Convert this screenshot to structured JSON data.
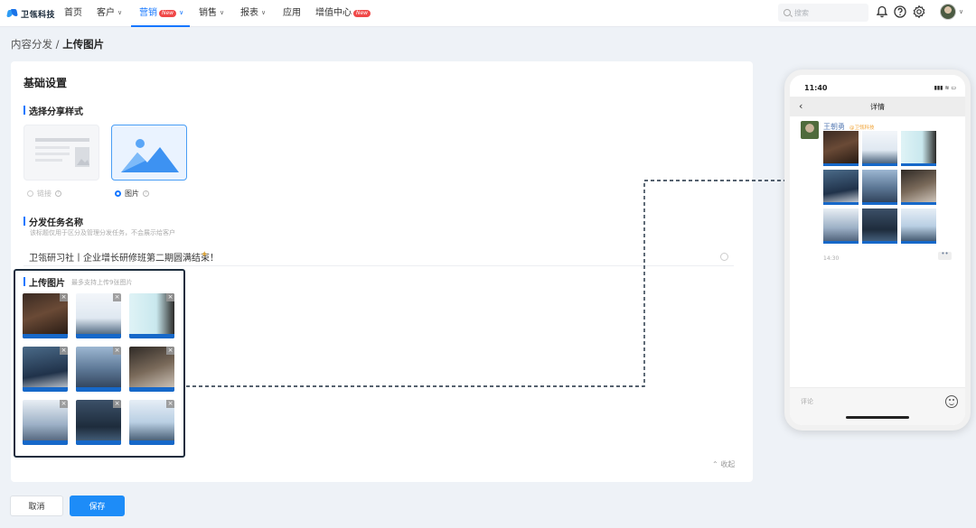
{
  "brand": {
    "name": "卫瓴科技",
    "accent": "#1677ff",
    "save_color": "#1d8cf8",
    "badge_color": "#f04848"
  },
  "nav": {
    "items": [
      {
        "label": "首页",
        "dropdown": false,
        "badge": ""
      },
      {
        "label": "客户",
        "dropdown": true,
        "badge": ""
      },
      {
        "label": "营销",
        "dropdown": true,
        "badge": "New",
        "active": true
      },
      {
        "label": "销售",
        "dropdown": true,
        "badge": ""
      },
      {
        "label": "报表",
        "dropdown": true,
        "badge": ""
      },
      {
        "label": "应用",
        "dropdown": false,
        "badge": ""
      },
      {
        "label": "增值中心",
        "dropdown": false,
        "badge": "New"
      }
    ],
    "search_placeholder": "搜索",
    "icons": [
      "bell-icon",
      "help-icon",
      "gear-icon"
    ]
  },
  "breadcrumb": {
    "parent": "内容分发",
    "separator": " / ",
    "current": "上传图片"
  },
  "form": {
    "section_title": "基础设置",
    "share_style": {
      "title": "选择分享样式",
      "options": [
        {
          "label": "链接",
          "selected": false
        },
        {
          "label": "图片",
          "selected": true
        }
      ]
    },
    "task_name": {
      "title": "分发任务名称",
      "hint": "该标题仅用于区分及管理分发任务，不会展示给客户",
      "value": "卫瓴研习社丨企业增长研修班第二期圆满结束！"
    },
    "upload": {
      "title": "上传图片",
      "hint": "最多支持上传9张图片",
      "image_count": 9
    },
    "collapse_label": "收起",
    "cancel_label": "取消",
    "save_label": "保存"
  },
  "phone_preview": {
    "time": "11:40",
    "status": "▮▮▮ ≋ ▭",
    "header_title": "详情",
    "sender_name": "王朝勇",
    "sender_org": "@卫瓴科技",
    "post_time": "14:30",
    "more_label": "••",
    "comment_placeholder": "评论",
    "image_count": 9
  }
}
